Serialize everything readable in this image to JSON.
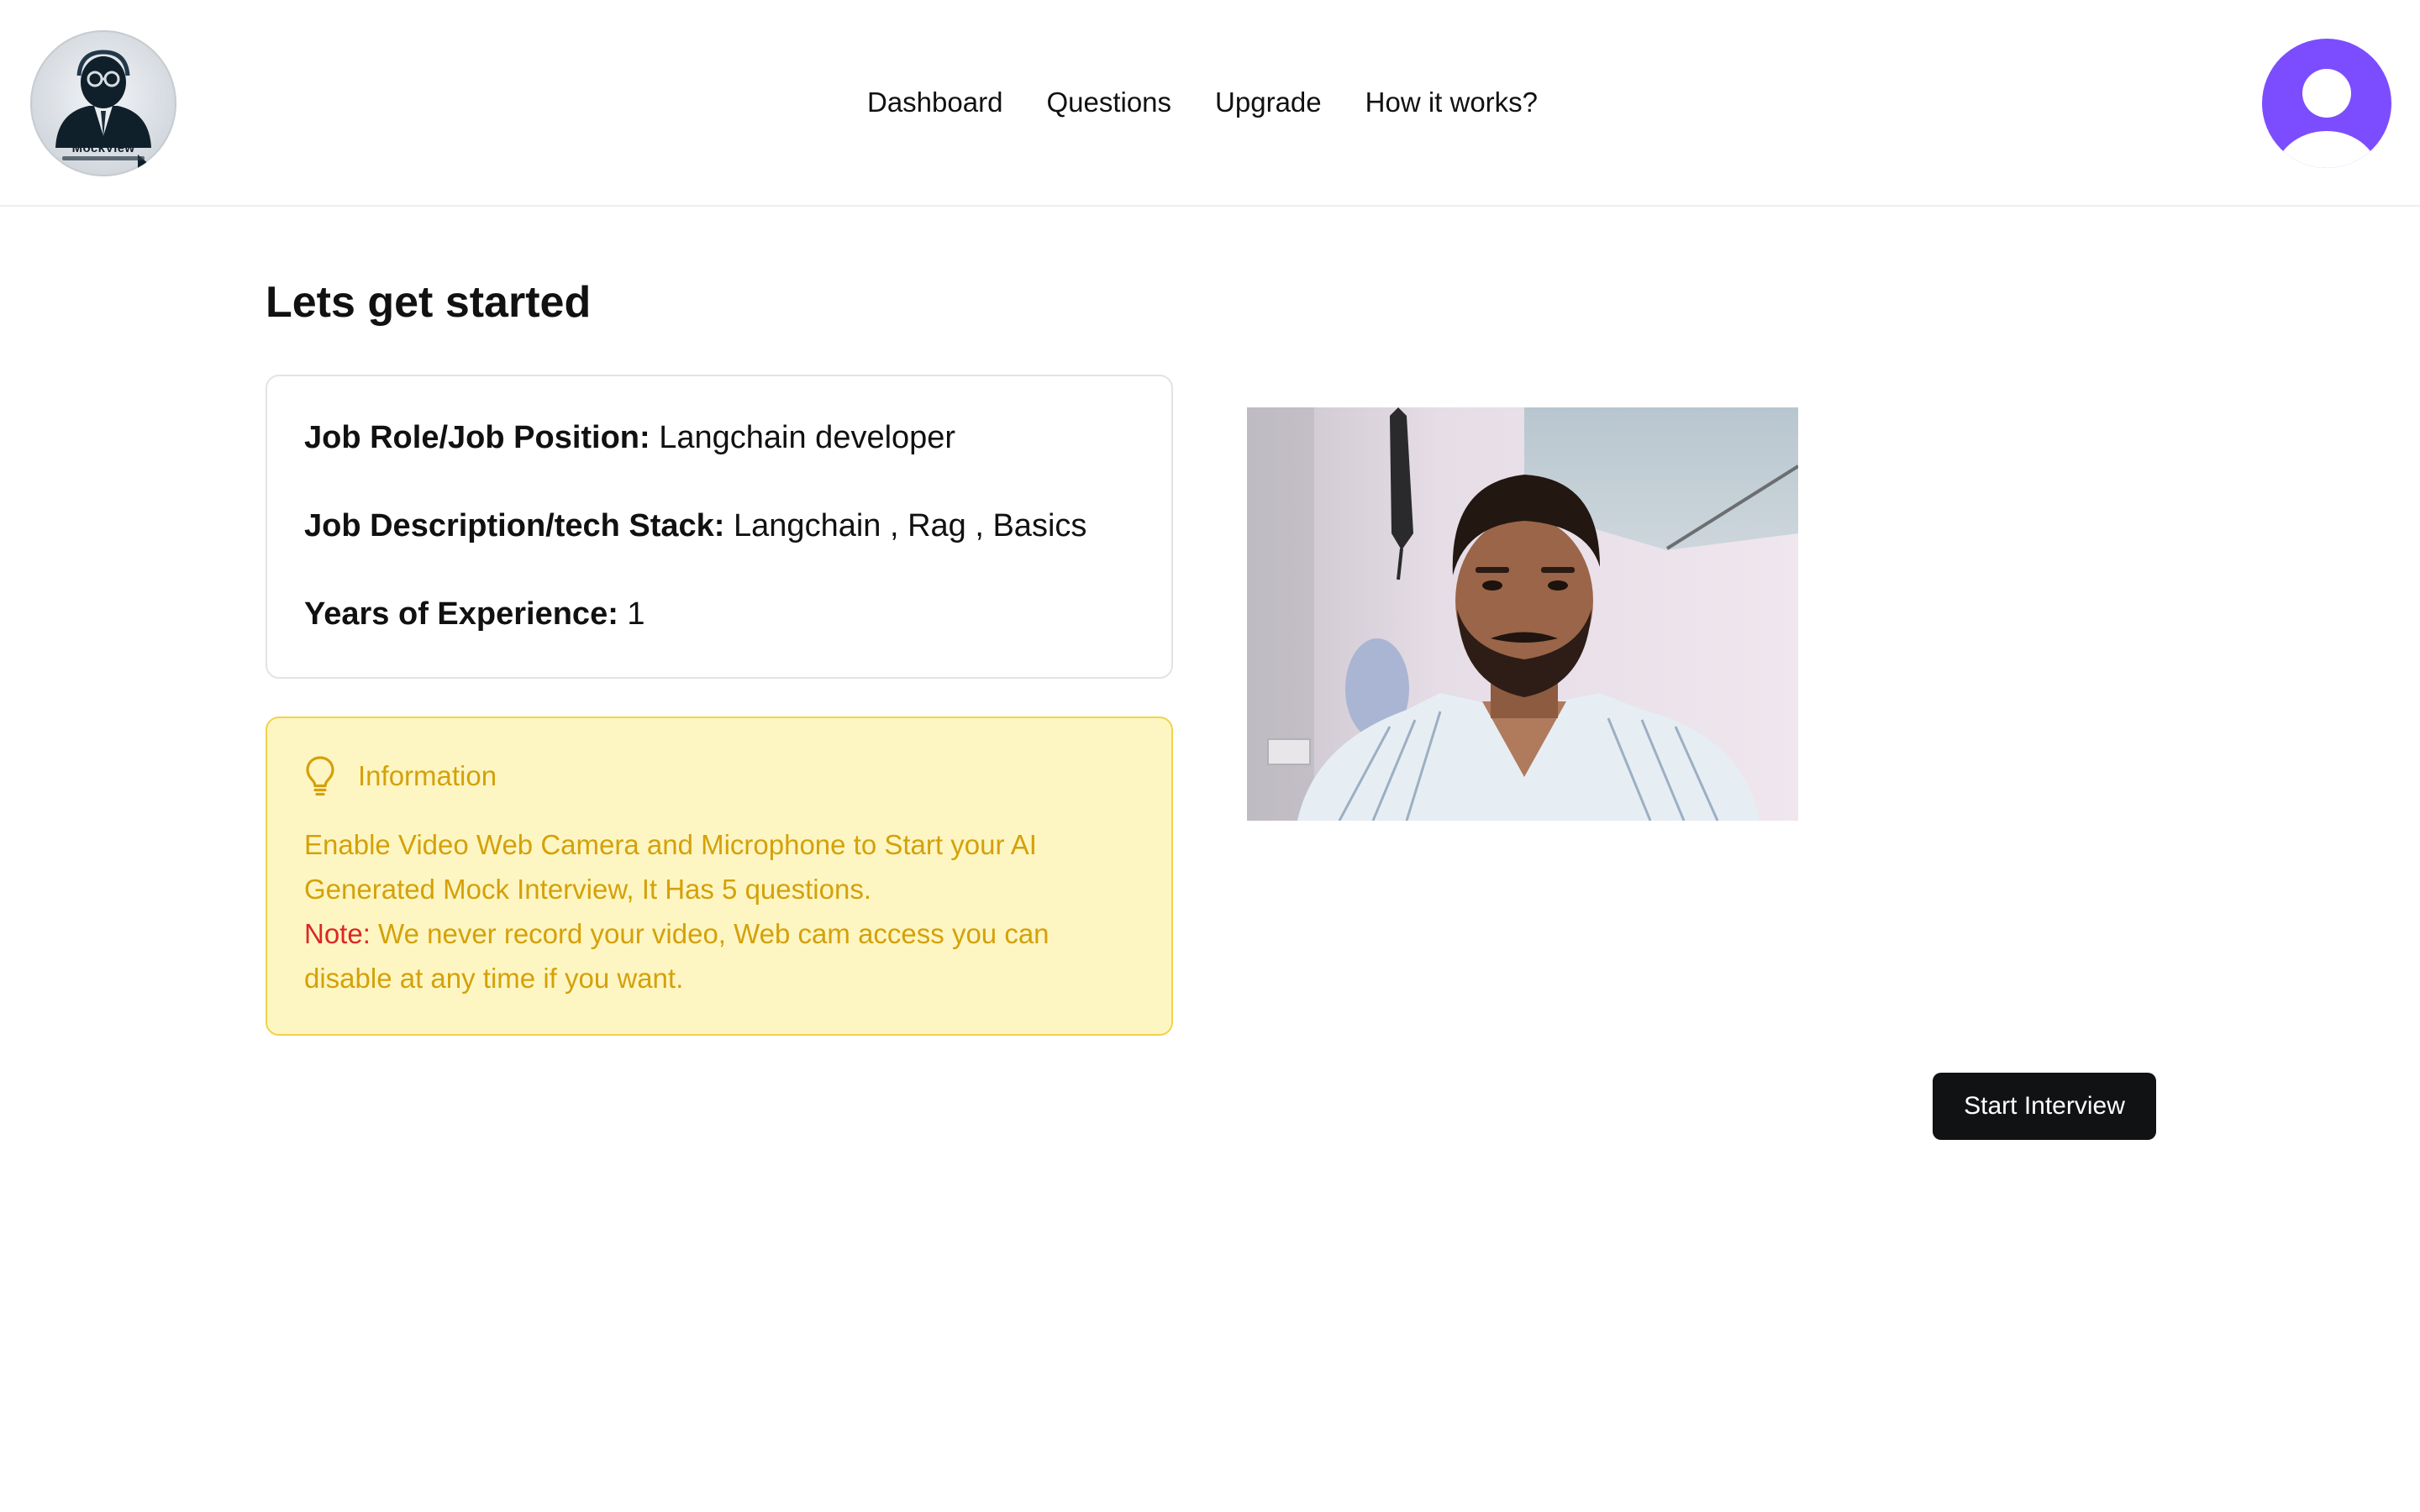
{
  "header": {
    "logo": {
      "name": "MockView",
      "icon": "spy-mascot-logo"
    },
    "nav": [
      {
        "label": "Dashboard"
      },
      {
        "label": "Questions"
      },
      {
        "label": "Upgrade"
      },
      {
        "label": "How it works?"
      }
    ],
    "avatar": {
      "icon": "user-avatar-icon",
      "color": "#7c4dff"
    }
  },
  "main": {
    "title": "Lets get started",
    "job": {
      "role_label": "Job Role/Job Position:",
      "role_value": "Langchain developer",
      "desc_label": "Job Description/tech Stack:",
      "desc_value": "Langchain , Rag , Basics",
      "exp_label": "Years of Experience:",
      "exp_value": "1"
    },
    "info": {
      "icon": "lightbulb-icon",
      "heading": "Information",
      "text": "Enable Video Web Camera and Microphone to Start your AI Generated Mock Interview, It Has 5 questions.",
      "note_label": "Note:",
      "note_text": "We never record your video, Web cam access you can disable at any time if you want."
    },
    "camera": {
      "icon": "webcam-preview"
    },
    "start_button": "Start Interview"
  },
  "colors": {
    "accent": "#7c4dff",
    "info_bg": "#fef6c2",
    "info_text": "#d4a10a",
    "note_red": "#dc2626",
    "button_bg": "#111214"
  }
}
